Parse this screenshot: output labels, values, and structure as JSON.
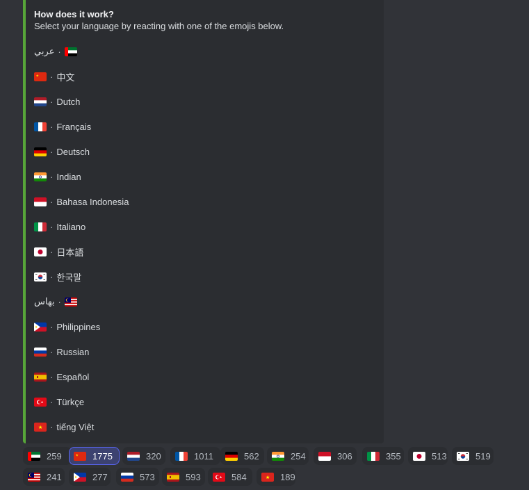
{
  "embed": {
    "accent": "#57a639",
    "title": "How does it work?",
    "description": "Select your language by reacting with one of the emojis below.",
    "separator": "·",
    "languages": [
      {
        "label": "عربي",
        "flag": "uae-flag",
        "rtl": true
      },
      {
        "label": "中文",
        "flag": "china-flag"
      },
      {
        "label": "Dutch",
        "flag": "netherlands-flag"
      },
      {
        "label": "Français",
        "flag": "france-flag"
      },
      {
        "label": "Deutsch",
        "flag": "germany-flag"
      },
      {
        "label": "Indian",
        "flag": "india-flag"
      },
      {
        "label": "Bahasa Indonesia",
        "flag": "indonesia-flag"
      },
      {
        "label": "Italiano",
        "flag": "italy-flag"
      },
      {
        "label": "日本語",
        "flag": "japan-flag"
      },
      {
        "label": "한국말",
        "flag": "korea-flag"
      },
      {
        "label": "بهاس",
        "flag": "malaysia-flag",
        "rtl": true
      },
      {
        "label": "Philippines",
        "flag": "philippines-flag"
      },
      {
        "label": "Russian",
        "flag": "russia-flag"
      },
      {
        "label": "Español",
        "flag": "spain-flag"
      },
      {
        "label": "Türkçe",
        "flag": "turkey-flag"
      },
      {
        "label": "tiếng Việt",
        "flag": "vietnam-flag"
      }
    ]
  },
  "reactions": [
    {
      "flag": "uae-flag",
      "count": "259"
    },
    {
      "flag": "china-flag",
      "count": "1775",
      "active": true
    },
    {
      "flag": "netherlands-flag",
      "count": "320"
    },
    {
      "flag": "france-flag",
      "count": "1011"
    },
    {
      "flag": "germany-flag",
      "count": "562"
    },
    {
      "flag": "india-flag",
      "count": "254"
    },
    {
      "flag": "indonesia-flag",
      "count": "306"
    },
    {
      "flag": "italy-flag",
      "count": "355"
    },
    {
      "flag": "japan-flag",
      "count": "513"
    },
    {
      "flag": "korea-flag",
      "count": "519"
    },
    {
      "flag": "malaysia-flag",
      "count": "241"
    },
    {
      "flag": "philippines-flag",
      "count": "277"
    },
    {
      "flag": "russia-flag",
      "count": "573"
    },
    {
      "flag": "spain-flag",
      "count": "593"
    },
    {
      "flag": "turkey-flag",
      "count": "584"
    },
    {
      "flag": "vietnam-flag",
      "count": "189"
    }
  ]
}
